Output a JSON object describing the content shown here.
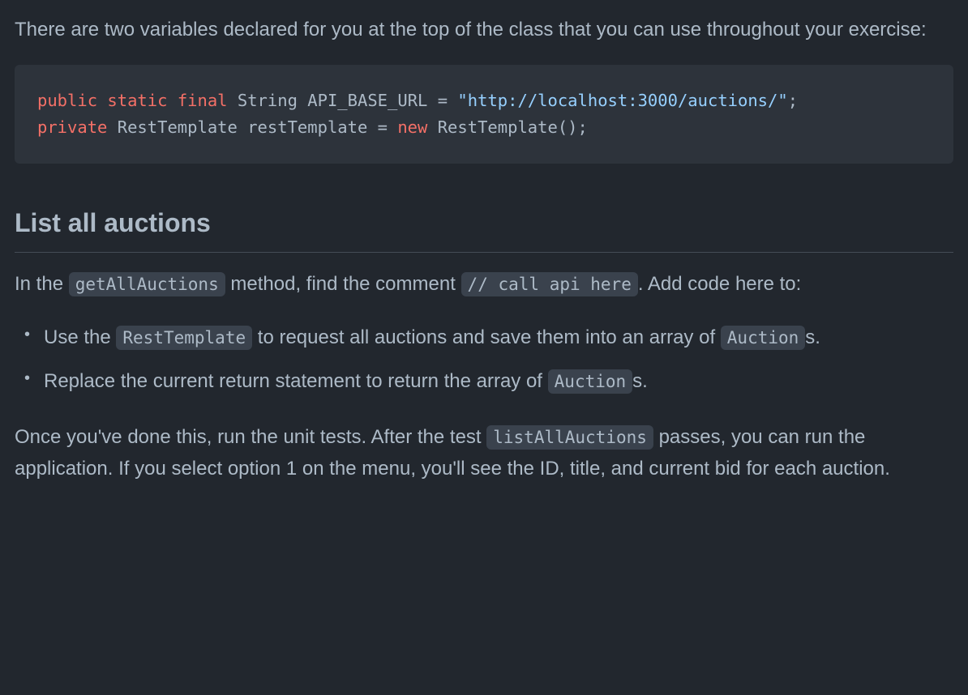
{
  "intro": "There are two variables declared for you at the top of the class that you can use throughout your exercise:",
  "code": {
    "line1": {
      "kw1": "public",
      "kw2": "static",
      "kw3": "final",
      "type": "String",
      "name": "API_BASE_URL",
      "eq": "=",
      "str": "\"http://localhost:3000/auctions/\"",
      "semi": ";"
    },
    "line2": {
      "kw1": "private",
      "type1": "RestTemplate",
      "name": "restTemplate",
      "eq": "=",
      "kw2": "new",
      "type2": "RestTemplate()",
      "semi": ";"
    }
  },
  "heading": "List all auctions",
  "para1": {
    "t1": "In the ",
    "code1": "getAllAuctions",
    "t2": " method, find the comment ",
    "code2": "// call api here",
    "t3": ". Add code here to:"
  },
  "bullets": {
    "b1": {
      "t1": "Use the ",
      "code1": "RestTemplate",
      "t2": " to request all auctions and save them into an array of ",
      "code2": "Auction",
      "t3": "s."
    },
    "b2": {
      "t1": "Replace the current return statement to return the array of ",
      "code1": "Auction",
      "t2": "s."
    }
  },
  "para2": {
    "t1": "Once you've done this, run the unit tests. After the test ",
    "code1": "listAllAuctions",
    "t2": " passes, you can run the application. If you select option 1 on the menu, you'll see the ID, title, and current bid for each auction."
  }
}
